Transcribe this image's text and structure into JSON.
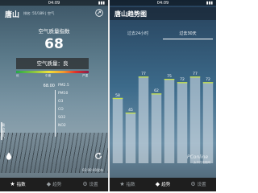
{
  "status_bar": {
    "time_left": "04:09",
    "time_right": "04:09",
    "signal": "▮▮▮"
  },
  "left_screen": {
    "city": "唐山",
    "rank_text": "排名: 55/189 | 空气",
    "aqi_title": "空气质量指数",
    "aqi_value": "68",
    "quality_label": "空气质量：良",
    "scale_labels": [
      "优",
      "中度",
      "严重"
    ],
    "pollutants": [
      {
        "name": "PM2.5",
        "value": "68.00"
      },
      {
        "name": "PM10",
        "value": ""
      },
      {
        "name": "O3",
        "value": ""
      },
      {
        "name": "CO",
        "value": ""
      },
      {
        "name": "SO2",
        "value": ""
      },
      {
        "name": "NO2",
        "value": ""
      }
    ],
    "side_label": "周边空气",
    "updated": "02:00:00发布",
    "tabs": [
      {
        "icon": "★",
        "label": "指数"
      },
      {
        "icon": "◆",
        "label": "趋势"
      },
      {
        "icon": "⚙",
        "label": "设置"
      }
    ]
  },
  "right_screen": {
    "title": "唐山趋势图",
    "tabs": [
      "过去24小时",
      "过去30天"
    ],
    "active_tab": 1,
    "watermark": "PConline",
    "watermark_sub": "太平洋电脑网"
  },
  "chart_data": {
    "type": "bar",
    "categories": [
      "",
      "",
      "",
      "",
      "",
      "",
      "",
      ""
    ],
    "values": [
      58,
      45,
      77,
      62,
      75,
      72,
      77,
      72
    ],
    "data_labels": [
      "58",
      "45",
      "77",
      "62",
      "75",
      "72",
      "77",
      "72"
    ],
    "ylim": [
      0,
      100
    ],
    "bar_color": "rgba(220,230,236,0.55)",
    "top_line_color": "#c6e24a",
    "grid": false
  },
  "colors": {
    "active_tab": "#ffffff",
    "tabbar_bg": "#1e1e1e"
  }
}
